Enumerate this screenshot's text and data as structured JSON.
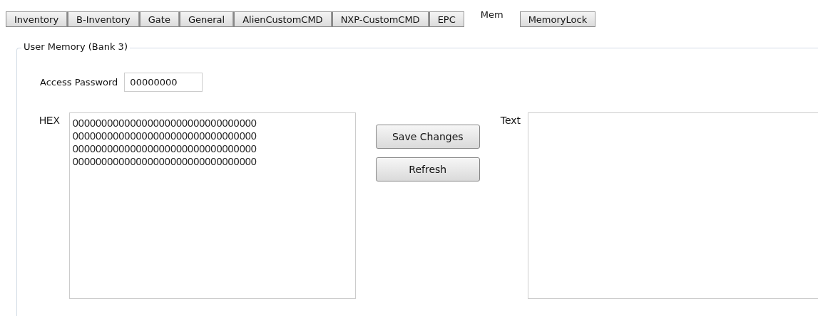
{
  "tabs": [
    {
      "label": "Inventory",
      "selected": false
    },
    {
      "label": "B-Inventory",
      "selected": false
    },
    {
      "label": "Gate",
      "selected": false
    },
    {
      "label": "General",
      "selected": false
    },
    {
      "label": "AlienCustomCMD",
      "selected": false
    },
    {
      "label": "NXP-CustomCMD",
      "selected": false
    },
    {
      "label": "EPC",
      "selected": false
    },
    {
      "label": "Mem",
      "selected": true
    },
    {
      "label": "MemoryLock",
      "selected": false
    }
  ],
  "group": {
    "title": "User Memory (Bank 3)",
    "access_password": {
      "label": "Access Password",
      "value": "00000000"
    },
    "hex": {
      "label": "HEX",
      "value": "00000000000000000000000000000000\n00000000000000000000000000000000\n00000000000000000000000000000000\n00000000000000000000000000000000"
    },
    "buttons": [
      "Save Changes",
      "Refresh"
    ],
    "text": {
      "label": "Text"
    }
  }
}
